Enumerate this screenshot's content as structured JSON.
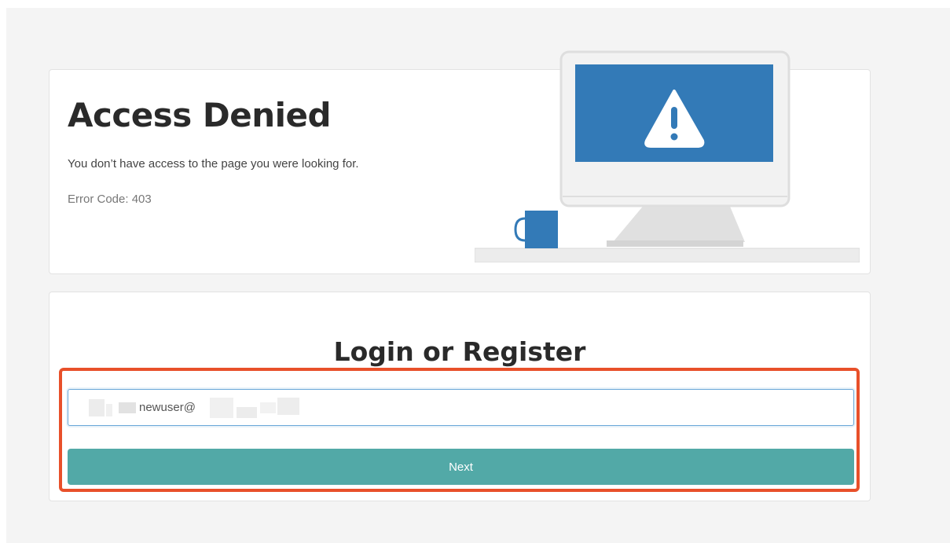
{
  "error": {
    "title": "Access Denied",
    "message": "You don’t have access to the page you were looking for.",
    "code_text": "Error Code: 403"
  },
  "illustration": {
    "icons": [
      "warning-icon",
      "monitor-icon",
      "mug-icon"
    ],
    "colors": {
      "screen": "#337ab7",
      "monitor_frame": "#ececec",
      "stand": "#dcdcdc",
      "mug": "#337ab7"
    }
  },
  "login": {
    "title": "Login or Register",
    "email_value": "newuser@",
    "next_label": "Next"
  },
  "colors": {
    "highlight_border": "#e8502a",
    "button_bg": "#52a9a7",
    "input_border": "#6aa8d8"
  }
}
